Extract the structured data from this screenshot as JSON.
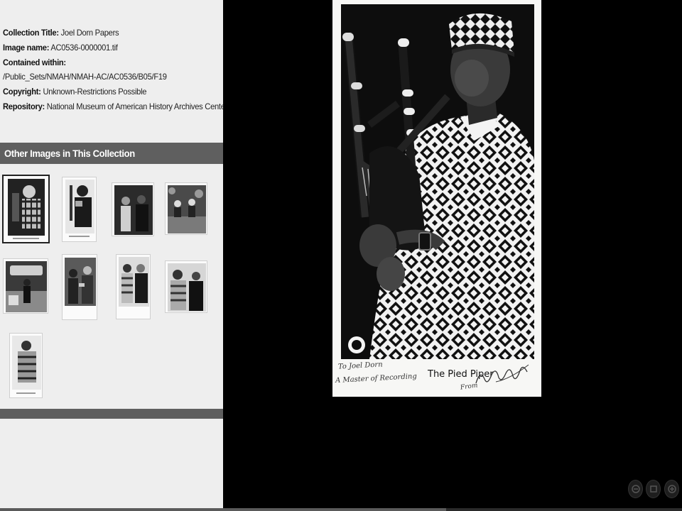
{
  "metadata": {
    "collection": {
      "label": "Collection Title:",
      "value": "Joel Dorn Papers"
    },
    "image_name": {
      "label": "Image name:",
      "value": "AC0536-0000001.tif"
    },
    "contained_within": {
      "label": "Contained within:",
      "value": "/Public_Sets/NMAH/NMAH-AC/AC0536/B05/F19"
    },
    "copyright": {
      "label": "Copyright:",
      "value": "Unknown-Restrictions Possible"
    },
    "repository": {
      "label": "Repository:",
      "value": "National Museum of American History Archives Center"
    }
  },
  "section": {
    "title": "Other Images in This Collection"
  },
  "thumbnails": [
    {
      "selected": true
    },
    {
      "selected": false
    },
    {
      "selected": false
    },
    {
      "selected": false
    },
    {
      "selected": false
    },
    {
      "selected": false
    },
    {
      "selected": false
    },
    {
      "selected": false
    },
    {
      "selected": false
    }
  ],
  "viewer": {
    "inscription_line1": "To Joel Dorn",
    "inscription_line2": "A Master of Recording",
    "printed_caption": "The Pied Piper",
    "signature_from": "From"
  },
  "nav_buttons": [
    {
      "icon": "zoom-out-icon"
    },
    {
      "icon": "reset-icon"
    },
    {
      "icon": "zoom-in-icon"
    }
  ]
}
